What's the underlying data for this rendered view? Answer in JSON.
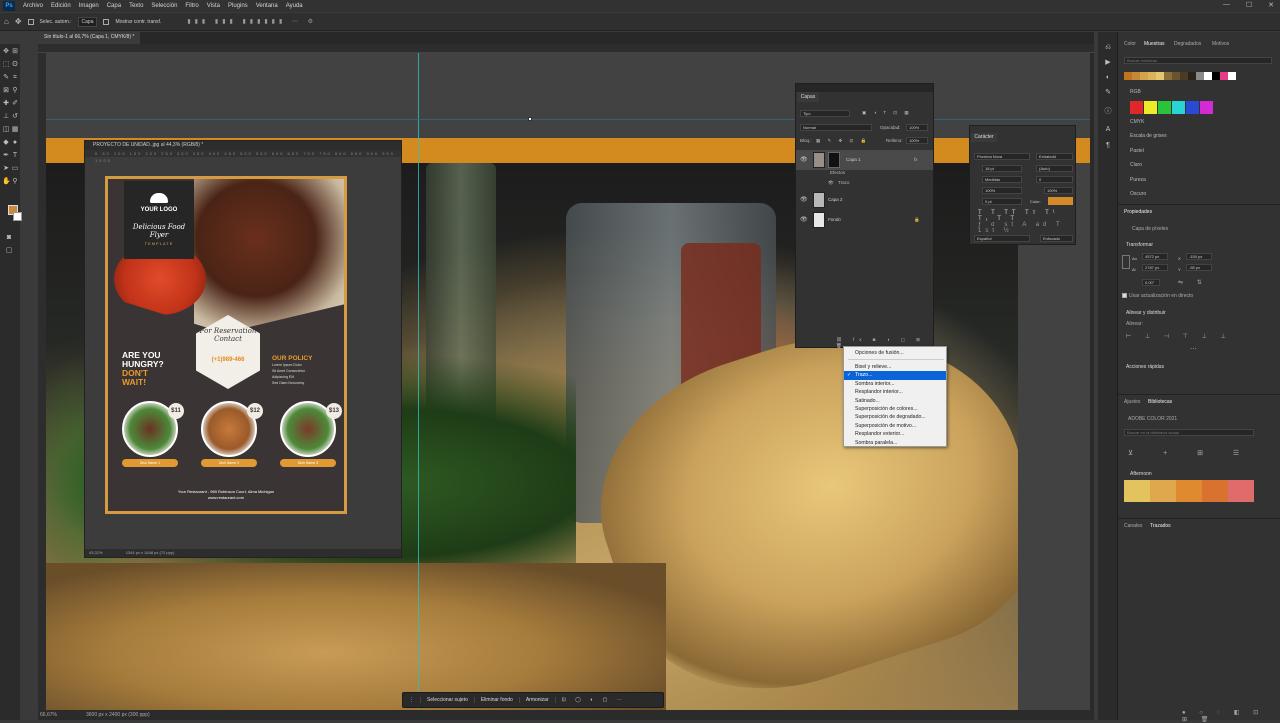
{
  "menu": [
    "Archivo",
    "Edición",
    "Imagen",
    "Capa",
    "Texto",
    "Selección",
    "Filtro",
    "Vista",
    "Plugins",
    "Ventana",
    "Ayuda"
  ],
  "options": {
    "auto_select": "Selec. autom.:",
    "layer": "Capa",
    "show_controls": "Mostrar contr. transf."
  },
  "doc_tab": "Sin título-1 al 66,7% (Capa 1, CMYK/8) *",
  "status": {
    "zoom": "66,67%",
    "dims": "3600 px x 2400 px (300 ppp)"
  },
  "float_doc": {
    "title": "PROYECTO DE UNIDAD..jpg al 44,3% (RGB/8) *",
    "ruler": "0 50 100 150 200 250 300 350 400 450 500 550 600 650 700 750 800 850 900 950 1000",
    "zoom": "43,32%",
    "dims": "1344 px x 1848 px (72 ppp)"
  },
  "flyer": {
    "logo": "YOUR LOGO",
    "title": "Delicious Food Flyer",
    "template": "TEMPLATE",
    "reservation": "For Reservation Contact",
    "phone": "(+1)989-466",
    "hungry1": "ARE YOU",
    "hungry2": "HUNGRY?",
    "hungry3": "DON'T",
    "hungry4": "WAIT!",
    "policy_title": "OUR POLICY",
    "policy": [
      "Lorem Ipsum Dolor",
      "Sit Amet Consectetur",
      "Adipiscing Elit",
      "Sed Diam Nonummy"
    ],
    "prices": [
      "$11",
      "$12",
      "$13"
    ],
    "dishes": [
      "Dish Name 1",
      "Dish Name 2",
      "Dish Name 3"
    ],
    "address": "Your Restaurant - 969 Robinson Court, Alma Michigan",
    "web": "www.restaurant.com"
  },
  "layers": {
    "tab": "Capas",
    "kind": "Tipo",
    "blend": "Normal",
    "opacity_label": "Opacidad:",
    "opacity": "100%",
    "lock": "Bloq.:",
    "fill_label": "Relleno:",
    "fill": "100%",
    "items": [
      {
        "name": "Capa 1",
        "fx": "fx"
      },
      {
        "name": "Efectos"
      },
      {
        "name": "Trazo"
      },
      {
        "name": "Capa 2"
      },
      {
        "name": "Fondo"
      }
    ]
  },
  "fx_menu": {
    "items": [
      "Opciones de fusión...",
      "Bisel y relieve...",
      "Trazo...",
      "Sombra interior...",
      "Resplandor interior...",
      "Satinado...",
      "Superposición de colores...",
      "Superposición de degradado...",
      "Superposición de motivo...",
      "Resplandor exterior...",
      "Sombra paralela..."
    ],
    "checked": "Trazo..."
  },
  "character": {
    "tab": "Carácter",
    "font": "Proxima Nova",
    "style": "Extrabold",
    "size": "18 pt",
    "leading": "(Auto)",
    "kerning": "Medidas",
    "tracking": "0",
    "vscale": "100%",
    "hscale": "100%",
    "baseline": "0 pt",
    "color_label": "Color:",
    "lang": "Español",
    "aa": "Enfocado"
  },
  "right_panel": {
    "tabs": [
      "Color",
      "Muestras",
      "Degradados",
      "Motivos"
    ],
    "search": "Buscar muestras",
    "folders": [
      "RGB",
      "CMYK",
      "Escala de grises",
      "Pastel",
      "Claro",
      "Pureza",
      "Oscuro"
    ],
    "swatch_colors": [
      "#c0741e",
      "#c7873a",
      "#d3a24a",
      "#dcb25a",
      "#e3c66e",
      "#8a6d38",
      "#6a5330",
      "#4a3b24",
      "#2d2419",
      "#8a8a8a",
      "#ffffff",
      "#000000",
      "#e83a8a",
      "#ffffff"
    ],
    "rgb_colors": [
      "#e0282a",
      "#eeea2a",
      "#2ac43a",
      "#2ad4d4",
      "#2a4ad4",
      "#d42ad4"
    ],
    "props_tabs": [
      "Propiedades"
    ],
    "pixel_layer": "Capa de píxeles",
    "transform": "Transformar",
    "w": "4572 px",
    "x": "-150 px",
    "h": "2787 px",
    "y": "-55 px",
    "angle": "0,00°",
    "auto_update": "Usar actualización en directo",
    "align": "Alinear y distribuir",
    "align_label": "Alinear:",
    "quick": "Acciones rápidas",
    "libs_tabs": [
      "Ajustes",
      "Bibliotecas"
    ],
    "lib_name": "ADOBE COLOR 2021",
    "lib_search": "Buscar en la biblioteca actual",
    "theme_name": "Afternoon",
    "theme_colors": [
      "#e3c35e",
      "#e0a84c",
      "#e08a30",
      "#d9722e",
      "#e06b6b"
    ],
    "bottom_tabs": [
      "Canales",
      "Trazados"
    ]
  },
  "ctx_bar": [
    "Seleccionar sujeto",
    "Eliminar fondo",
    "Armonizar"
  ]
}
